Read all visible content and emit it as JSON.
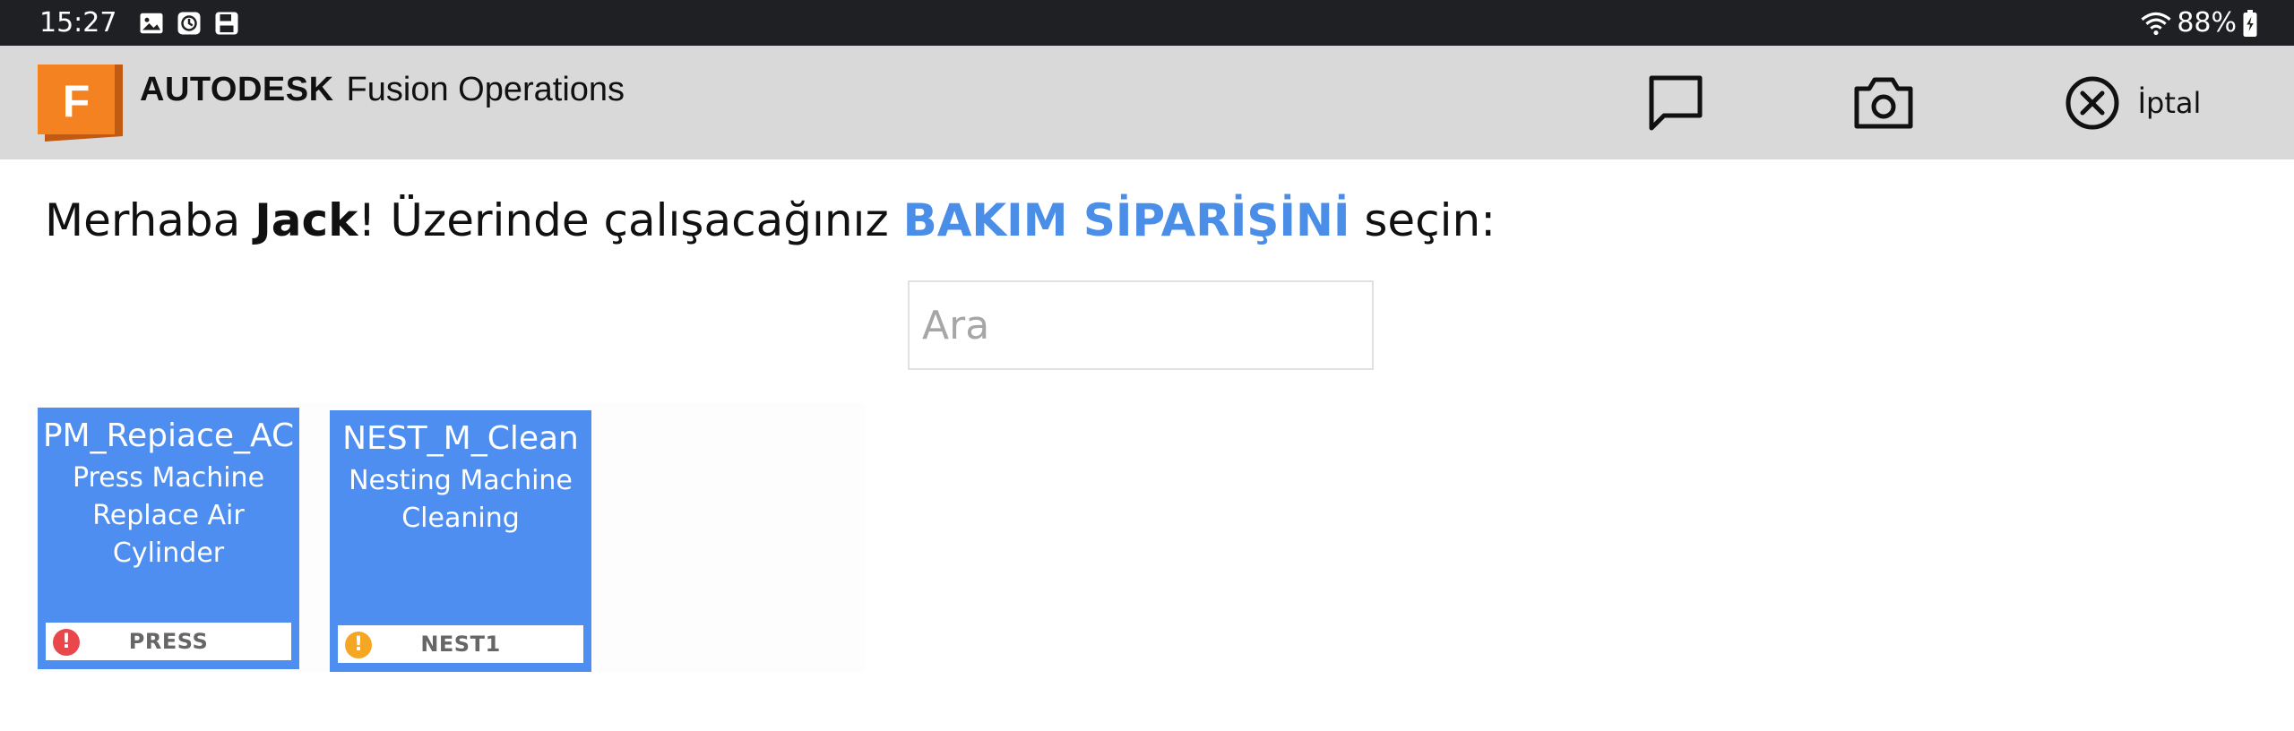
{
  "status_bar": {
    "time": "15:27",
    "battery": "88%",
    "icons": [
      "image-icon",
      "clock-icon",
      "save-icon"
    ],
    "right_icons": [
      "wifi-icon",
      "battery-icon"
    ]
  },
  "header": {
    "logo_letter": "F",
    "brand_main": "AUTODESK",
    "brand_sub": "Fusion Operations",
    "chat_icon": "chat-icon",
    "camera_icon": "camera-icon",
    "cancel_icon": "close-circle-icon",
    "cancel_label": "İptal",
    "logo_color": "#f58220"
  },
  "greeting": {
    "prefix": "Merhaba ",
    "name": "Jack",
    "middle": "! Üzerinde çalışacağınız ",
    "highlight": "BAKIM SİPARİŞİNİ",
    "suffix": " seçin:",
    "highlight_color": "#4a8ee8"
  },
  "search": {
    "placeholder": "Ara",
    "value": ""
  },
  "orders": [
    {
      "code": "PM_Repiace_AC",
      "description": "Press Machine Replace Air Cylinder",
      "location": "PRESS",
      "priority": "high",
      "priority_symbol": "!",
      "priority_icon": "error-icon"
    },
    {
      "code": "NEST_M_Clean",
      "description": "Nesting Machine Cleaning",
      "location": "NEST1",
      "priority": "medium",
      "priority_symbol": "!",
      "priority_icon": "warning-icon"
    }
  ],
  "colors": {
    "card_bg": "#4e8ef0",
    "priority_high": "#e8474b",
    "priority_medium": "#f5a623"
  }
}
